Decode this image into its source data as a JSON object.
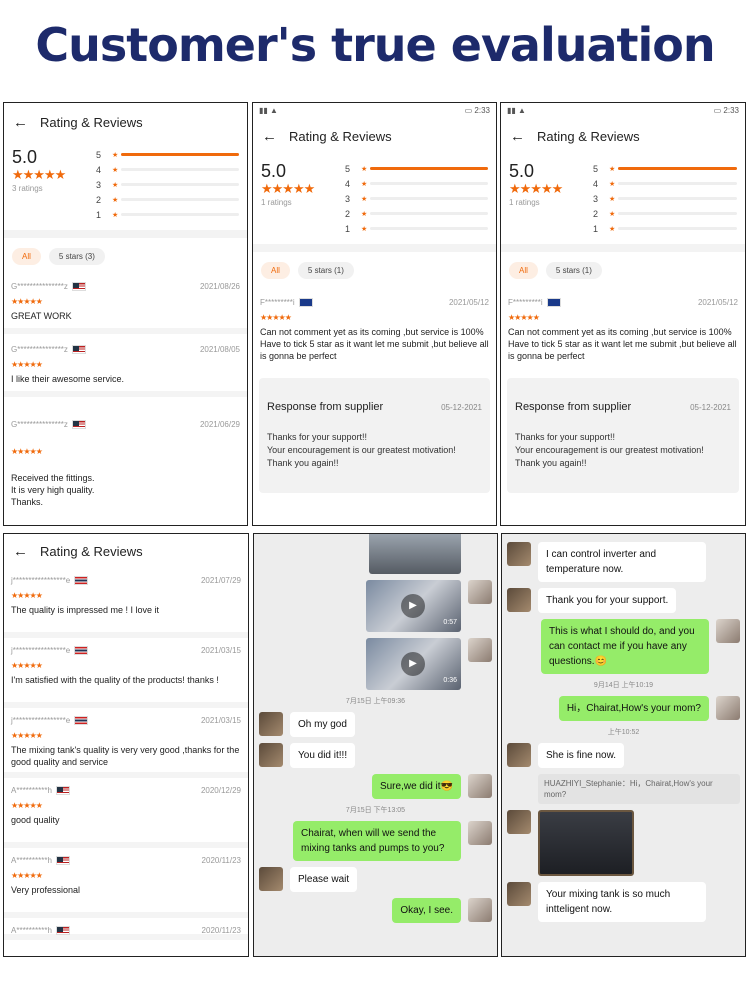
{
  "headline": "Customer's true evaluation",
  "header_title": "Rating & Reviews",
  "score": "5.0",
  "bar_labels": [
    "5",
    "4",
    "3",
    "2",
    "1"
  ],
  "chip_all": "All",
  "panel1": {
    "ratings": "3 ratings",
    "chip": "5 stars (3)",
    "reviews": [
      {
        "name": "G***************z",
        "date": "2021/08/26",
        "text": "GREAT WORK"
      },
      {
        "name": "G***************z",
        "date": "2021/08/05",
        "text": "I like their awesome service."
      },
      {
        "name": "G***************z",
        "date": "2021/06/29",
        "text": "Received the fittings.\nIt is very high quality.\nThanks."
      }
    ]
  },
  "panel2": {
    "status_time": "2:33",
    "ratings": "1 ratings",
    "chip": "5 stars (1)",
    "review": {
      "name": "F*********i",
      "date": "2021/05/12",
      "text": "Can not comment yet as its coming ,but service is 100% Have to tick 5 star as it want let me submit ,but believe all is gonna be perfect"
    },
    "response": {
      "title": "Response from supplier",
      "date": "05-12-2021",
      "text": "Thanks for your support!!\nYour  encouragement is our greatest motivation!\nThank you again!!"
    }
  },
  "panel4": {
    "reviews": [
      {
        "name": "j*****************e",
        "date": "2021/07/29",
        "flag": "th",
        "text": "The quality is impressed me ! I love it"
      },
      {
        "name": "j*****************e",
        "date": "2021/03/15",
        "flag": "th",
        "text": "I'm satisfied with the quality of the products! thanks !"
      },
      {
        "name": "j*****************e",
        "date": "2021/03/15",
        "flag": "th",
        "text": "The mixing tank's quality is very very good ,thanks for the good quality and service"
      },
      {
        "name": "A**********h",
        "date": "2020/12/29",
        "flag": "us",
        "text": "good quality"
      },
      {
        "name": "A**********h",
        "date": "2020/11/23",
        "flag": "us",
        "text": "Very professional"
      },
      {
        "name": "A**********h",
        "date": "2020/11/23",
        "flag": "us",
        "text": ""
      }
    ]
  },
  "panel5": {
    "video1_duration": "0:57",
    "video2_duration": "0:36",
    "time1": "7月15日 上午09:36",
    "msg1": "Oh my god",
    "msg2": "You did it!!!",
    "msg3": "Sure,we did it😎",
    "time2": "7月15日 下午13:05",
    "msg4": "Chairat, when will we send the mixing tanks and pumps to you?",
    "msg5": "Please wait",
    "msg6": "Okay, I see."
  },
  "panel6": {
    "msg1": "I can control inverter and temperature now.",
    "msg2": "Thank you for your support.",
    "msg3": "This is what I should do, and you can contact me if you have any questions.😊",
    "time1": "9月14日 上午10:19",
    "msg4": "Hi，Chairat,How's your mom?",
    "time2": "上午10:52",
    "msg5": "She is fine now.",
    "quote": "HUAZHIYI_Stephanie：Hi，Chairat,How's your mom?",
    "msg6": "Your mixing tank is so much intteligent now."
  }
}
